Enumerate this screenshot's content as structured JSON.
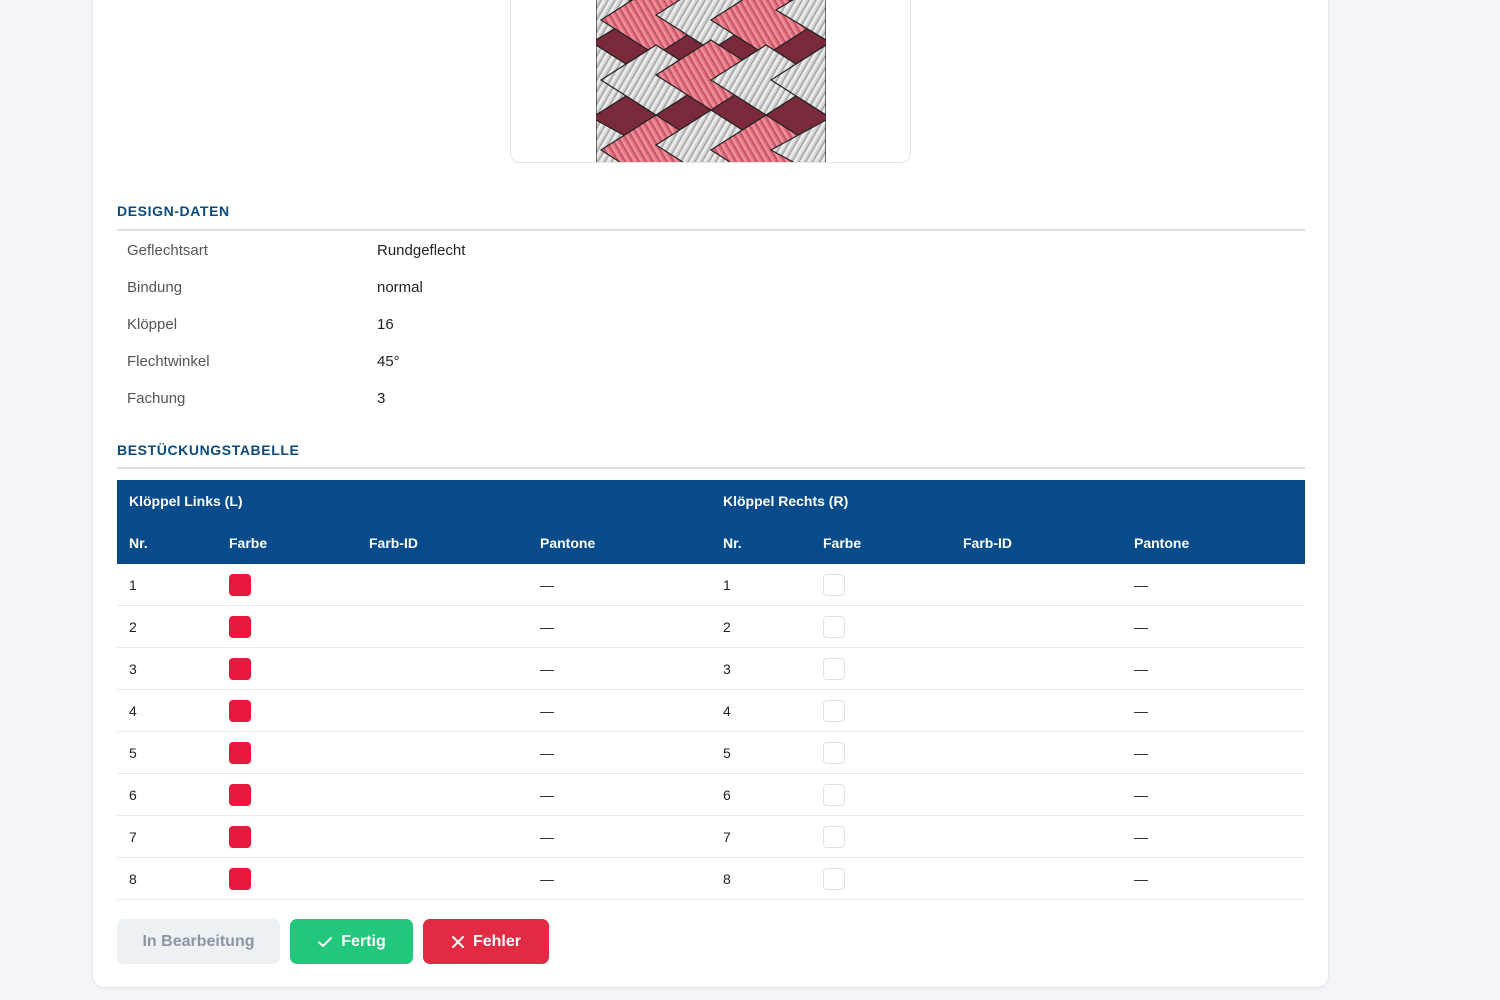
{
  "colors": {
    "accent": "#074b8a",
    "strand_red": "#e8173d",
    "success": "#21c77a",
    "danger": "#e02b43"
  },
  "design": {
    "title": "DESIGN-DATEN",
    "rows": [
      {
        "label": "Geflechtsart",
        "value": "Rundgeflecht"
      },
      {
        "label": "Bindung",
        "value": "normal"
      },
      {
        "label": "Klöppel",
        "value": "16"
      },
      {
        "label": "Flechtwinkel",
        "value": "45°"
      },
      {
        "label": "Fachung",
        "value": "3"
      }
    ]
  },
  "table": {
    "title": "BESTÜCKUNGSTABELLE",
    "group_left": "Klöppel Links (L)",
    "group_right": "Klöppel Rechts (R)",
    "columns": [
      "Nr.",
      "Farbe",
      "Farb-ID",
      "Pantone"
    ],
    "empty_marker": "—",
    "rows": [
      {
        "l_nr": "1",
        "l_color": "red",
        "r_nr": "1",
        "r_color": "empty"
      },
      {
        "l_nr": "2",
        "l_color": "red",
        "r_nr": "2",
        "r_color": "empty"
      },
      {
        "l_nr": "3",
        "l_color": "red",
        "r_nr": "3",
        "r_color": "empty"
      },
      {
        "l_nr": "4",
        "l_color": "red",
        "r_nr": "4",
        "r_color": "empty"
      },
      {
        "l_nr": "5",
        "l_color": "red",
        "r_nr": "5",
        "r_color": "empty"
      },
      {
        "l_nr": "6",
        "l_color": "red",
        "r_nr": "6",
        "r_color": "empty"
      },
      {
        "l_nr": "7",
        "l_color": "red",
        "r_nr": "7",
        "r_color": "empty"
      },
      {
        "l_nr": "8",
        "l_color": "red",
        "r_nr": "8",
        "r_color": "empty"
      }
    ]
  },
  "buttons": {
    "in_progress": "In Bearbeitung",
    "done": "Fertig",
    "error": "Fehler"
  },
  "icons": {
    "done": "check-icon",
    "error": "close-icon"
  }
}
